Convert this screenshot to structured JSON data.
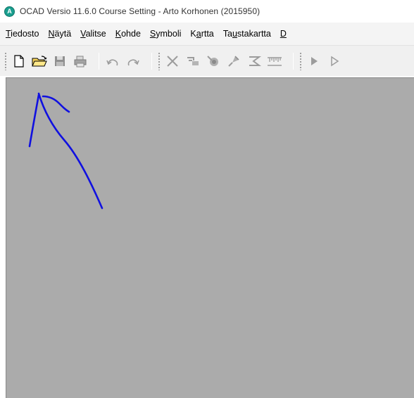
{
  "window": {
    "title": "OCAD Versio 11.6.0  Course Setting - Arto Korhonen (2015950)",
    "app_icon_letter": "A",
    "app_icon_color": "#1a9e8f"
  },
  "menu": [
    {
      "pre": "",
      "u": "T",
      "post": "iedosto"
    },
    {
      "pre": "",
      "u": "N",
      "post": "äytä"
    },
    {
      "pre": "",
      "u": "V",
      "post": "alitse"
    },
    {
      "pre": "",
      "u": "K",
      "post": "ohde"
    },
    {
      "pre": "",
      "u": "S",
      "post": "ymboli"
    },
    {
      "pre": "K",
      "u": "a",
      "post": "rtta"
    },
    {
      "pre": "Ta",
      "u": "u",
      "post": "stakartta"
    },
    {
      "pre": "",
      "u": "D",
      "post": ""
    }
  ],
  "toolbar": {
    "icons": [
      "new-icon",
      "open-icon",
      "save-icon",
      "print-icon",
      "undo-icon",
      "redo-icon",
      "cut-icon",
      "step-icon",
      "tool-a-icon",
      "tool-b-icon",
      "tool-c-icon",
      "ruler-icon",
      "pointer-icon",
      "pointer-outline-icon"
    ]
  },
  "workspace": {
    "background": "#ababab",
    "annotation_color": "#1010e0",
    "annotation_icon": "arrow-annotation-icon"
  }
}
